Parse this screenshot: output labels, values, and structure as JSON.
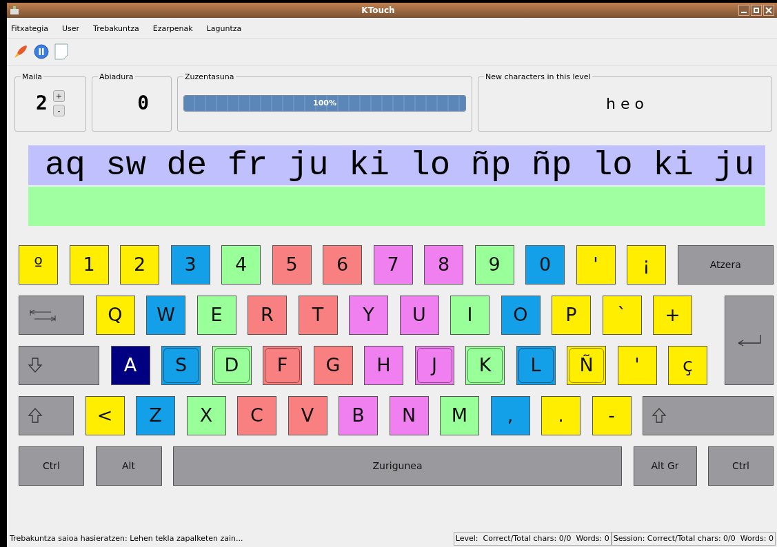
{
  "window": {
    "title": "KTouch"
  },
  "menu": [
    "Fitxategia",
    "User",
    "Trebakuntza",
    "Ezarpenak",
    "Laguntza"
  ],
  "level_box": {
    "label": "Maila",
    "value": "2",
    "buttons": [
      "+",
      "-"
    ]
  },
  "speed_box": {
    "label": "Abiadura",
    "value": "0"
  },
  "accuracy_box": {
    "label": "Zuzentasuna",
    "level": 1.0,
    "reading": "100%"
  },
  "new_chars_box": {
    "label": "New characters in this level",
    "text": "h e o"
  },
  "practice": {
    "text": "aq sw de fr ju ki lo ñp ñp lo ki ju"
  },
  "keyboard": {
    "rows": [
      {
        "keys": [
          {
            "kind": "char",
            "label": "º",
            "color": "#ffee00",
            "selected": false,
            "home": false
          },
          {
            "kind": "char",
            "label": "1",
            "color": "#ffee00",
            "selected": false,
            "home": false
          },
          {
            "kind": "char",
            "label": "2",
            "color": "#ffee00",
            "selected": false,
            "home": false
          },
          {
            "kind": "char",
            "label": "3",
            "color": "#13a0e8",
            "selected": false,
            "home": false
          },
          {
            "kind": "char",
            "label": "4",
            "color": "#99ff99",
            "selected": false,
            "home": false
          },
          {
            "kind": "char",
            "label": "5",
            "color": "#f88080",
            "selected": false,
            "home": false
          },
          {
            "kind": "char",
            "label": "6",
            "color": "#f88080",
            "selected": false,
            "home": false
          },
          {
            "kind": "char",
            "label": "7",
            "color": "#f080f0",
            "selected": false,
            "home": false
          },
          {
            "kind": "char",
            "label": "8",
            "color": "#f080f0",
            "selected": false,
            "home": false
          },
          {
            "kind": "char",
            "label": "9",
            "color": "#99ff99",
            "selected": false,
            "home": false
          },
          {
            "kind": "char",
            "label": "0",
            "color": "#13a0e8",
            "selected": false,
            "home": false
          },
          {
            "kind": "char",
            "label": "'",
            "color": "#ffee00",
            "selected": false,
            "home": false
          },
          {
            "kind": "char",
            "label": "¡",
            "color": "#ffee00",
            "selected": false,
            "home": false
          },
          {
            "kind": "backspace",
            "label": "Atzera"
          }
        ]
      },
      {
        "keys": [
          {
            "kind": "tab"
          },
          {
            "kind": "char",
            "label": "Q",
            "color": "#ffee00",
            "selected": false,
            "home": false
          },
          {
            "kind": "char",
            "label": "W",
            "color": "#13a0e8",
            "selected": false,
            "home": false
          },
          {
            "kind": "char",
            "label": "E",
            "color": "#99ff99",
            "selected": false,
            "home": false
          },
          {
            "kind": "char",
            "label": "R",
            "color": "#f88080",
            "selected": false,
            "home": false
          },
          {
            "kind": "char",
            "label": "T",
            "color": "#f88080",
            "selected": false,
            "home": false
          },
          {
            "kind": "char",
            "label": "Y",
            "color": "#f080f0",
            "selected": false,
            "home": false
          },
          {
            "kind": "char",
            "label": "U",
            "color": "#f080f0",
            "selected": false,
            "home": false
          },
          {
            "kind": "char",
            "label": "I",
            "color": "#99ff99",
            "selected": false,
            "home": false
          },
          {
            "kind": "char",
            "label": "O",
            "color": "#13a0e8",
            "selected": false,
            "home": false
          },
          {
            "kind": "char",
            "label": "P",
            "color": "#ffee00",
            "selected": false,
            "home": false
          },
          {
            "kind": "char",
            "label": "`",
            "color": "#ffee00",
            "selected": false,
            "home": false
          },
          {
            "kind": "char",
            "label": "+",
            "color": "#ffee00",
            "selected": false,
            "home": false
          },
          {
            "kind": "enter"
          }
        ]
      },
      {
        "keys": [
          {
            "kind": "caps"
          },
          {
            "kind": "char",
            "label": "A",
            "color": "#000080",
            "selected": true,
            "home": false
          },
          {
            "kind": "char",
            "label": "S",
            "color": "#13a0e8",
            "selected": false,
            "home": true
          },
          {
            "kind": "char",
            "label": "D",
            "color": "#99ff99",
            "selected": false,
            "home": true
          },
          {
            "kind": "char",
            "label": "F",
            "color": "#f88080",
            "selected": false,
            "home": true
          },
          {
            "kind": "char",
            "label": "G",
            "color": "#f88080",
            "selected": false,
            "home": false
          },
          {
            "kind": "char",
            "label": "H",
            "color": "#f080f0",
            "selected": false,
            "home": false
          },
          {
            "kind": "char",
            "label": "J",
            "color": "#f080f0",
            "selected": false,
            "home": true
          },
          {
            "kind": "char",
            "label": "K",
            "color": "#99ff99",
            "selected": false,
            "home": true
          },
          {
            "kind": "char",
            "label": "L",
            "color": "#13a0e8",
            "selected": false,
            "home": true
          },
          {
            "kind": "char",
            "label": "Ñ",
            "color": "#ffee00",
            "selected": false,
            "home": true
          },
          {
            "kind": "char",
            "label": "'",
            "color": "#ffee00",
            "selected": false,
            "home": false
          },
          {
            "kind": "char",
            "label": "ç",
            "color": "#ffee00",
            "selected": false,
            "home": false
          }
        ]
      },
      {
        "keys": [
          {
            "kind": "shift"
          },
          {
            "kind": "char",
            "label": "<",
            "color": "#ffee00",
            "selected": false,
            "home": false
          },
          {
            "kind": "char",
            "label": "Z",
            "color": "#13a0e8",
            "selected": false,
            "home": false
          },
          {
            "kind": "char",
            "label": "X",
            "color": "#99ff99",
            "selected": false,
            "home": false
          },
          {
            "kind": "char",
            "label": "C",
            "color": "#f88080",
            "selected": false,
            "home": false
          },
          {
            "kind": "char",
            "label": "V",
            "color": "#f88080",
            "selected": false,
            "home": false
          },
          {
            "kind": "char",
            "label": "B",
            "color": "#f080f0",
            "selected": false,
            "home": false
          },
          {
            "kind": "char",
            "label": "N",
            "color": "#f080f0",
            "selected": false,
            "home": false
          },
          {
            "kind": "char",
            "label": "M",
            "color": "#99ff99",
            "selected": false,
            "home": false
          },
          {
            "kind": "char",
            "label": ",",
            "color": "#13a0e8",
            "selected": false,
            "home": false
          },
          {
            "kind": "char",
            "label": ".",
            "color": "#ffee00",
            "selected": false,
            "home": false
          },
          {
            "kind": "char",
            "label": "-",
            "color": "#ffee00",
            "selected": false,
            "home": false
          },
          {
            "kind": "shift"
          }
        ]
      },
      {
        "keys": [
          {
            "kind": "ctrl",
            "label": "Ctrl"
          },
          {
            "kind": "alt",
            "label": "Alt"
          },
          {
            "kind": "space",
            "label": "Zurigunea"
          },
          {
            "kind": "altgr",
            "label": "Alt Gr"
          },
          {
            "kind": "ctrl",
            "label": "Ctrl"
          }
        ]
      }
    ]
  },
  "status_bar": {
    "message": "Trebakuntza saioa hasieratzen: Lehen tekla zapalketen zain...",
    "level_stats": "Level:  Correct/Total chars: 0/0  Words: 0",
    "session_stats": "Session: Correct/Total chars: 0/0  Words: 0"
  }
}
